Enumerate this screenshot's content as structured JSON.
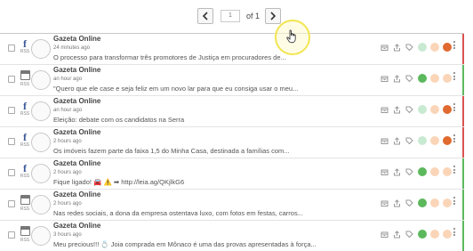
{
  "pagination": {
    "current_page": "1",
    "of_text": "of 1",
    "prev_label": "previous-page",
    "next_label": "next-page"
  },
  "colors": {
    "positive": "#5cb85c",
    "negative": "#d9534f",
    "sentiment_green_light": "#c9ead2",
    "sentiment_green": "#5cb85c",
    "sentiment_peach": "#fbd5b8",
    "sentiment_red": "#e06a2f",
    "cursor_highlight": "#f2e550"
  },
  "posts": [
    {
      "source": "facebook",
      "source_label": "RSS",
      "author": "Gazeta Online",
      "time": "24 minutes ago",
      "text": "O processo para transformar três promotores de Justiça em procuradores de...",
      "sentiment": "negative",
      "accent": "#d9534f"
    },
    {
      "source": "calendar",
      "source_label": "RSS",
      "author": "Gazeta Online",
      "time": "an hour ago",
      "text": "\"Quero que ele case e seja feliz em um novo lar para que eu consiga usar o meu...",
      "sentiment": "positive",
      "accent": "#5cb85c"
    },
    {
      "source": "facebook",
      "source_label": "RSS",
      "author": "Gazeta Online",
      "time": "an hour ago",
      "text": "Eleição: debate com os candidatos na Serra",
      "sentiment": "negative",
      "accent": "#d9534f"
    },
    {
      "source": "facebook",
      "source_label": "RSS",
      "author": "Gazeta Online",
      "time": "2 hours ago",
      "text": "Os imóveis fazem parte da faixa 1,5 do Minha Casa, destinada a famílias com...",
      "sentiment": "negative",
      "accent": "#d9534f"
    },
    {
      "source": "facebook",
      "source_label": "RSS",
      "author": "Gazeta Online",
      "time": "2 hours ago",
      "text": "Fique ligado! 🚘 ⚠️ ➡ http://leia.ag/QKjlkG6",
      "sentiment": "positive",
      "accent": "#5cb85c"
    },
    {
      "source": "calendar",
      "source_label": "RSS",
      "author": "Gazeta Online",
      "time": "2 hours ago",
      "text": "Nas redes sociais, a dona da empresa ostentava luxo, com fotos em festas, carros...",
      "sentiment": "positive",
      "accent": "#5cb85c"
    },
    {
      "source": "calendar",
      "source_label": "RSS",
      "author": "Gazeta Online",
      "time": "3 hours ago",
      "text": "Meu precious!!! 💍 Joia comprada em Mônaco é uma das provas apresentadas à força...",
      "sentiment": "positive",
      "accent": "#5cb85c"
    }
  ]
}
